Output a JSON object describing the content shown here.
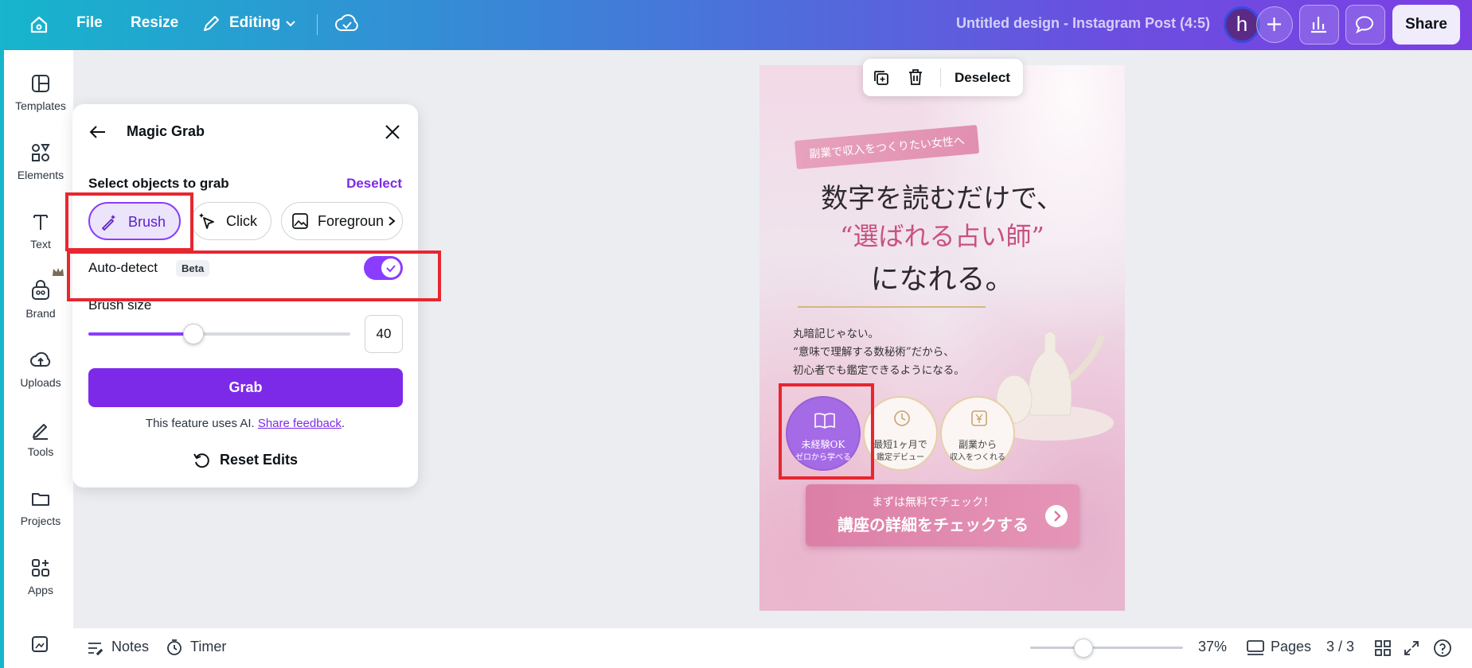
{
  "topbar": {
    "file": "File",
    "resize": "Resize",
    "editing": "Editing",
    "title": "Untitled design - Instagram Post (4:5)",
    "avatar_letter": "h",
    "share": "Share"
  },
  "rail": {
    "items": [
      {
        "label": "Templates",
        "icon": "templates-icon"
      },
      {
        "label": "Elements",
        "icon": "elements-icon"
      },
      {
        "label": "Text",
        "icon": "text-icon"
      },
      {
        "label": "Brand",
        "icon": "brand-icon"
      },
      {
        "label": "Uploads",
        "icon": "uploads-icon"
      },
      {
        "label": "Tools",
        "icon": "tools-icon"
      },
      {
        "label": "Projects",
        "icon": "projects-icon"
      },
      {
        "label": "Apps",
        "icon": "apps-icon"
      }
    ]
  },
  "panel": {
    "title": "Magic Grab",
    "section_label": "Select objects to grab",
    "deselect": "Deselect",
    "modes": [
      "Brush",
      "Click",
      "Foregroun"
    ],
    "selected_mode": "Brush",
    "autodetect_label": "Auto-detect",
    "beta": "Beta",
    "autodetect_on": true,
    "brush_size_label": "Brush size",
    "brush_size_value": "40",
    "brush_size_fraction": 0.4,
    "grab": "Grab",
    "ai_note": "This feature uses AI. ",
    "share_feedback": "Share feedback",
    "period": ".",
    "reset": "Reset Edits"
  },
  "floatbar": {
    "deselect": "Deselect"
  },
  "design": {
    "ribbon": "副業で収入をつくりたい女性へ",
    "line1": "数字を読むだけで、",
    "line2": "“選ばれる占い師”",
    "line3": "になれる。",
    "body1": "丸暗記じゃない。",
    "body2": "“意味で理解する数秘術”だから、",
    "body3": "初心者でも鑑定できるようになる。",
    "badges": [
      {
        "t1": "未経験OK",
        "t2": "ゼロから学べる"
      },
      {
        "t1": "最短1ヶ月で",
        "t2": "鑑定デビュー"
      },
      {
        "t1": "副業から",
        "t2": "収入をつくれる"
      }
    ],
    "cta_small": "まずは無料でチェック！",
    "cta_big": "講座の詳細をチェックする"
  },
  "bottombar": {
    "notes": "Notes",
    "timer": "Timer",
    "zoom": "37%",
    "zoom_fraction": 0.35,
    "pages": "Pages",
    "page_count": "3 / 3"
  },
  "colors": {
    "accent": "#7d2ae8",
    "annotation": "#e8262f"
  }
}
